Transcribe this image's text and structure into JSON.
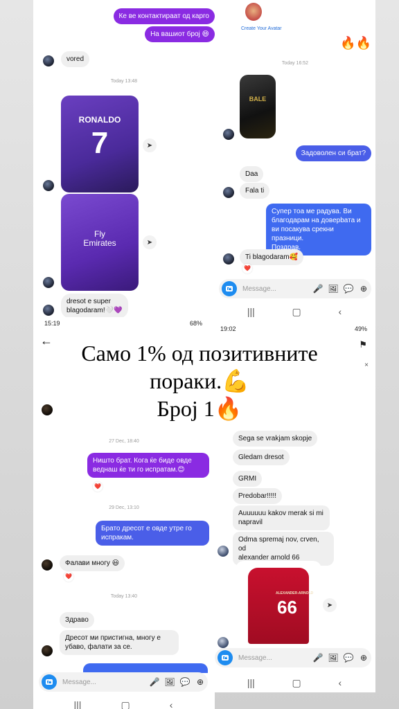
{
  "top_left": {
    "messages": [
      {
        "text": "Ке ве контактираат од карго"
      },
      {
        "text": "На вашиот број 😄"
      },
      {
        "text": "vored"
      },
      {
        "text": "dresot e super\nblagodaram!🤍💜"
      }
    ],
    "timestamp": "Today 13:48",
    "jersey1_name": "RONALDO",
    "jersey1_number": "7",
    "jersey2_text": "Fly\nEmirates"
  },
  "top_right": {
    "avatar_label": "Create Your Avatar",
    "fire_emoji": "🔥🔥",
    "timestamp": "Today 16:52",
    "messages": [
      {
        "text": "Задоволен си брат?"
      },
      {
        "text": "Daa"
      },
      {
        "text": "Fala ti"
      },
      {
        "text": "Супер тоа ме радува. Ви\nблагодарам на доверbата и\nви посакува срекни празници.\nПоздрав."
      },
      {
        "text": "Ti blagodaram🥰"
      }
    ],
    "jersey_name": "BALE",
    "input_placeholder": "Message...",
    "heart": "❤️"
  },
  "headline": {
    "line1": "Само 1% од позитивните",
    "line2": "пораки.💪",
    "line3": "Број 1🔥"
  },
  "bottom_left": {
    "status_time": "15:19",
    "status_battery": "68%",
    "timestamp1": "27 Dec, 18:40",
    "timestamp2": "29 Dec, 13:10",
    "timestamp3": "Today 13:40",
    "messages": [
      {
        "text": "Ништо брат. Кога ќе биде овде\nведнаш ќе ти го испратам.😊"
      },
      {
        "text": "Брато дресот е овде утре го\nиспракам."
      },
      {
        "text": "Фалави многу 😃"
      },
      {
        "text": "Здраво"
      },
      {
        "text": "Дресот ми пристигна, многу е\nубаво, фалати за се."
      }
    ],
    "input_placeholder": "Message...",
    "heart": "❤️"
  },
  "bottom_right": {
    "status_time": "19:02",
    "status_battery": "49%",
    "messages": [
      {
        "text": "Sega se vrakjam skopje"
      },
      {
        "text": "Gledam dresot"
      },
      {
        "text": "GRMI"
      },
      {
        "text": "Predobar!!!!!"
      },
      {
        "text": "Auuuuuu kakov merak si mi\nnapravil"
      },
      {
        "text": "Odma spremaj nov, crven, od\nalexander arnold 66"
      }
    ],
    "jersey_name": "ALEXANDER-ARNOLD",
    "jersey_number": "66",
    "input_placeholder": "Message..."
  },
  "colors": {
    "purple": "#8a2be2",
    "blue": "#4a5ee8",
    "camera": "#1e8cf0"
  }
}
